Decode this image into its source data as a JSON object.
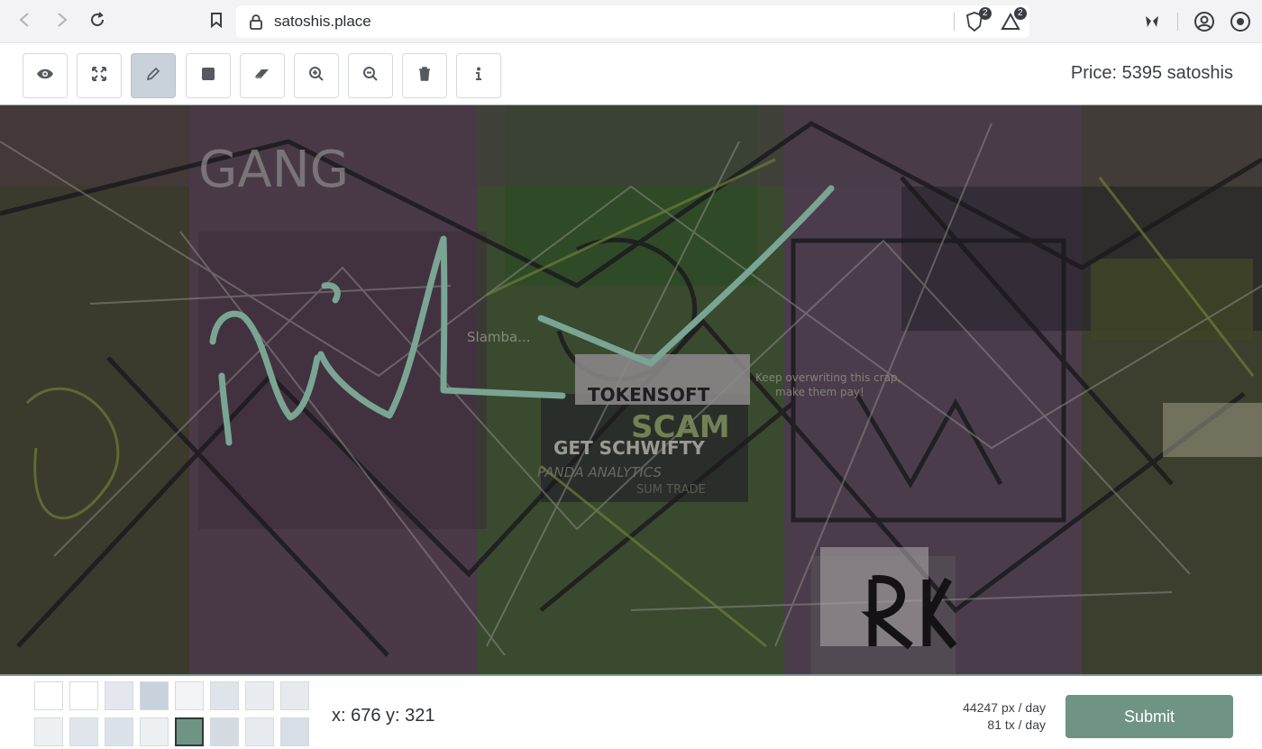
{
  "browser": {
    "url": "satoshis.place",
    "brave_badge": "2",
    "rewards_badge": "2"
  },
  "toolbar": {
    "tools": [
      {
        "name": "eye-icon",
        "label": "view"
      },
      {
        "name": "expand-icon",
        "label": "fullscreen"
      },
      {
        "name": "pencil-icon",
        "label": "draw",
        "active": true
      },
      {
        "name": "square-icon",
        "label": "rectangle"
      },
      {
        "name": "eraser-icon",
        "label": "eraser"
      },
      {
        "name": "zoom-in-icon",
        "label": "zoom in"
      },
      {
        "name": "zoom-out-icon",
        "label": "zoom out"
      },
      {
        "name": "trash-icon",
        "label": "clear"
      },
      {
        "name": "info-icon",
        "label": "info"
      }
    ],
    "price": "Price: 5395 satoshis"
  },
  "canvas": {
    "texts": [
      "GANG",
      "Slamba...",
      "TOKENSOFT",
      "Keep overwriting this crap,",
      "make them pay!",
      "SCAM",
      "GET SCHWIFTY",
      "PANDA ANALYTICS",
      "SUM TRADE"
    ],
    "stroke_color": "#7aa594"
  },
  "palette": {
    "row1": [
      "#ffffff",
      "#ffffff",
      "#e4e8ee",
      "#c8d2dc",
      "#f2f4f6",
      "#dfe4ea",
      "#e9edf1",
      "#e6eaee"
    ],
    "row2": [
      "#eef1f4",
      "#e1e6ec",
      "#dce2e9",
      "#edf0f3",
      "#6f9484",
      "#d4dbe3",
      "#e7ebf0",
      "#d7dee6"
    ],
    "selected": "#6f9484"
  },
  "status": {
    "coords": "x: 676 y: 321",
    "px_per_day": "44247 px / day",
    "tx_per_day": "81 tx / day"
  },
  "actions": {
    "submit": "Submit"
  },
  "colors": {
    "accent": "#6f9484",
    "active_tool": "#c9d2da"
  }
}
